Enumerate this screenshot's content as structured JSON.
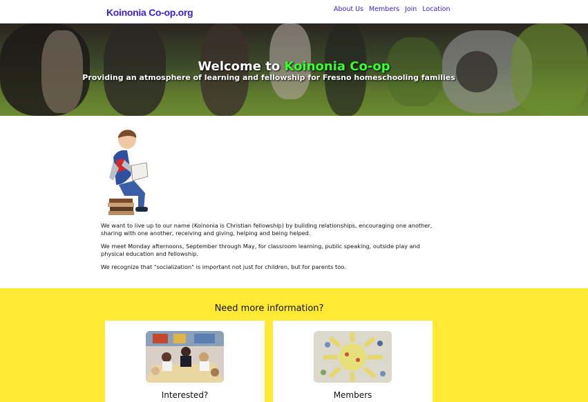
{
  "site": {
    "logo": "Koinonia Co-op.org"
  },
  "nav": {
    "items": [
      "About Us",
      "Members",
      "Join",
      "Location"
    ]
  },
  "hero": {
    "title_prefix": "Welcome to ",
    "title_accent": "Koinonia Co-op",
    "subtitle": "Providing an atmosphere of learning and fellowship for Fresno homeschooling families"
  },
  "content": {
    "paragraphs": [
      "We want to live up to our name (Koinonia is Christian fellowship) by building relationships, encouraging one another, sharing with one another, receiving and giving, helping and being helped.",
      "We meet Monday afternoons, September through May, for classroom learning, public speaking, outside play and physical education and fellowship.",
      "We recognize that \"socialization\" is important not just for children, but for parents too."
    ]
  },
  "info": {
    "title": "Need more information?",
    "cards": [
      {
        "label": "Interested?"
      },
      {
        "label": "Members"
      }
    ]
  },
  "colors": {
    "accent": "#3a1fd6",
    "hero_accent": "#39ff2e",
    "section_bg": "#ffe933"
  }
}
